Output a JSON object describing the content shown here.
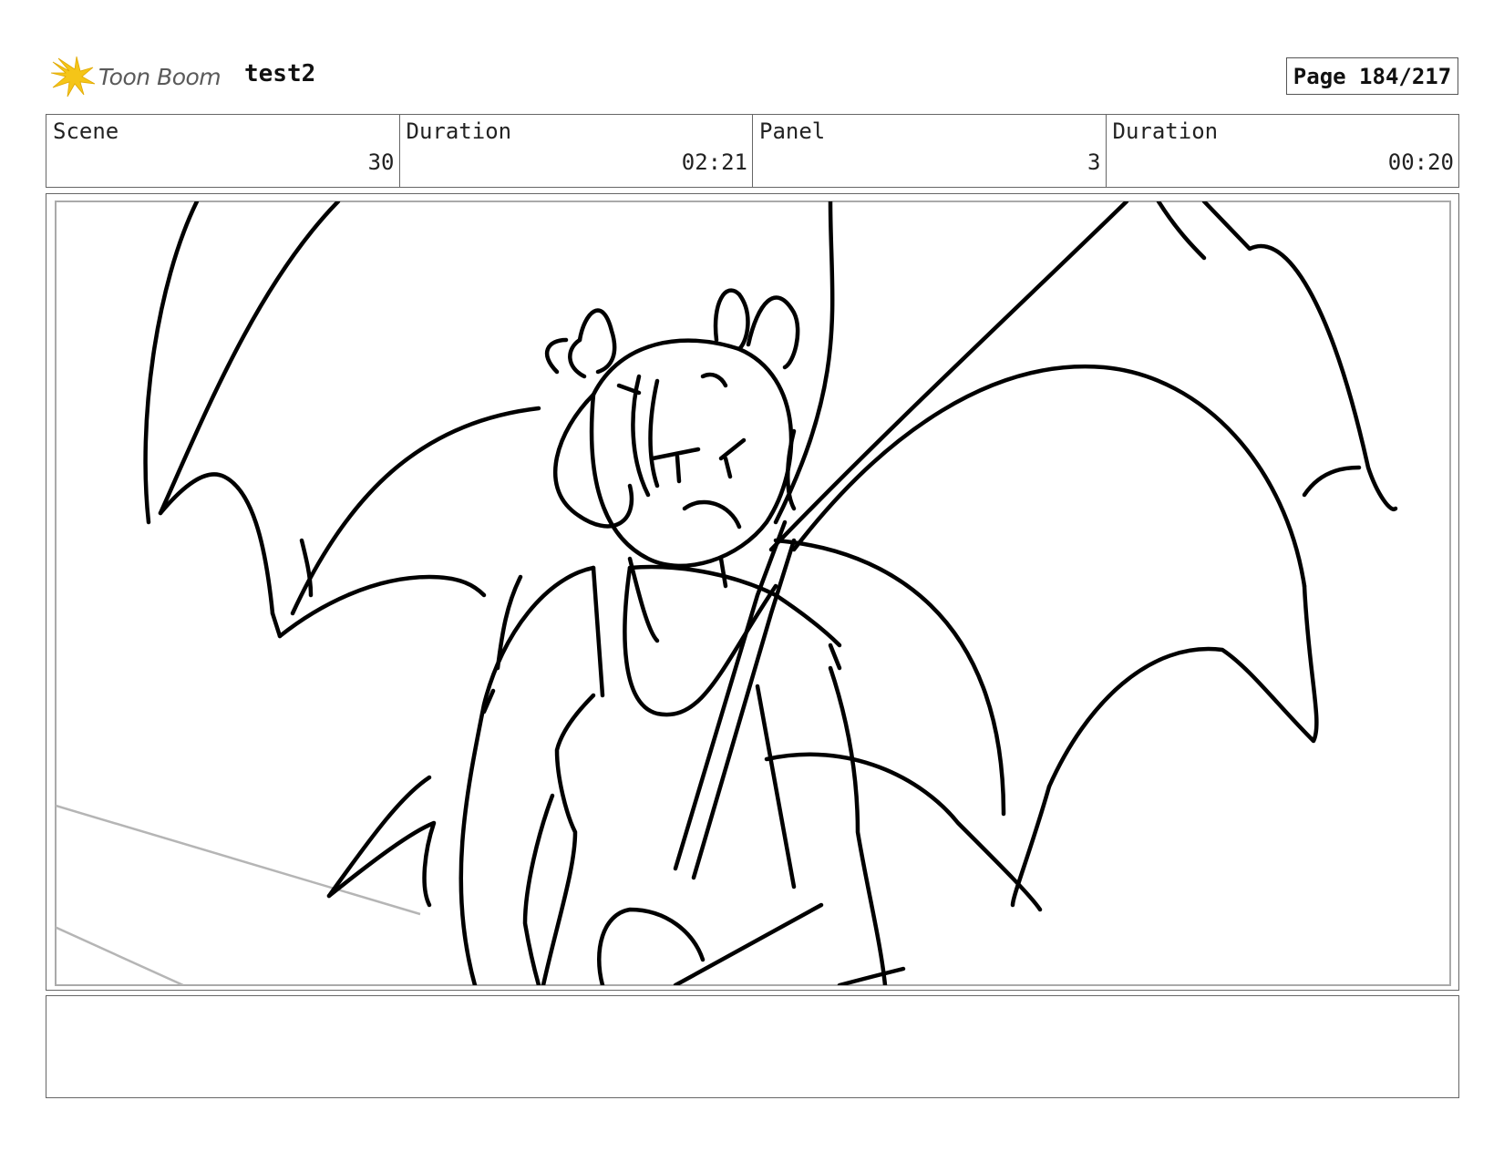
{
  "header": {
    "logo_text": "Toon Boom",
    "logo_icon": "toon-boom-spark-icon",
    "project_title": "test2",
    "page_label": "Page 184/217"
  },
  "info": {
    "scene_label": "Scene",
    "scene_value": "30",
    "scene_duration_label": "Duration",
    "scene_duration_value": "02:21",
    "panel_label": "Panel",
    "panel_value": "3",
    "panel_duration_label": "Duration",
    "panel_duration_value": "00:20"
  },
  "caption": {
    "text": ""
  },
  "colors": {
    "logo_yellow": "#f5c518",
    "logo_text": "#5a5a5a",
    "frame_border": "#666666",
    "sketch_line": "#000000",
    "guide_line": "#b5b5b5"
  }
}
